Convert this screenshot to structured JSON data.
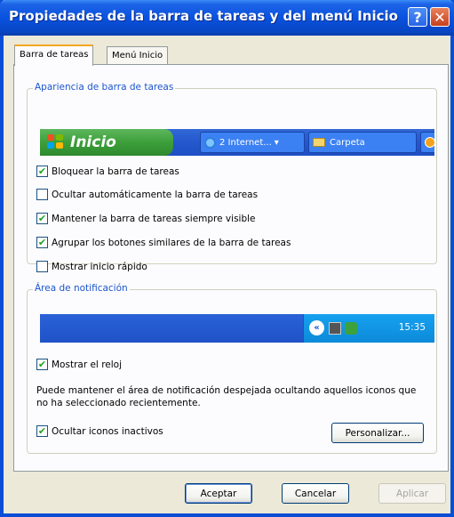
{
  "window": {
    "title": "Propiedades de la barra de tareas y del menú Inicio",
    "help_glyph": "?",
    "close_glyph": "✕"
  },
  "tabs": [
    {
      "label": "Barra de tareas",
      "active": true
    },
    {
      "label": "Menú Inicio",
      "active": false
    }
  ],
  "appearance": {
    "legend": "Apariencia de barra de tareas",
    "start_label": "Inicio",
    "taskbar_items": [
      {
        "label": "2 Internet...",
        "icon": "ie-icon",
        "dropdown_glyph": "▾"
      },
      {
        "label": "Carpeta",
        "icon": "folder-icon"
      }
    ],
    "checkboxes": [
      {
        "label": "Bloquear la barra de tareas",
        "checked": true
      },
      {
        "label": "Ocultar automáticamente la barra de tareas",
        "checked": false
      },
      {
        "label": "Mantener la barra de tareas siempre visible",
        "checked": true
      },
      {
        "label": "Agrupar los botones similares de la barra de tareas",
        "checked": true
      },
      {
        "label": "Mostrar inicio rápido",
        "checked": false
      }
    ]
  },
  "notification": {
    "legend": "Área de notificación",
    "tray_arrow_glyph": "«",
    "clock_time": "15:35",
    "show_clock": {
      "label": "Mostrar el reloj",
      "checked": true
    },
    "description": "Puede mantener el área de notificación despejada ocultando aquellos iconos que no ha seleccionado recientemente.",
    "hide_inactive": {
      "label": "Ocultar iconos inactivos",
      "checked": true
    },
    "customize_label": "Personalizar..."
  },
  "footer": {
    "ok_label": "Aceptar",
    "cancel_label": "Cancelar",
    "apply_label": "Aplicar"
  },
  "check_glyph": "✔",
  "colors": {
    "title_bar": "#0a52df",
    "start_button": "#3c9f3a",
    "taskbar": "#2457cd",
    "tray": "#0c8ad9",
    "legend_text": "#1b55cc"
  }
}
